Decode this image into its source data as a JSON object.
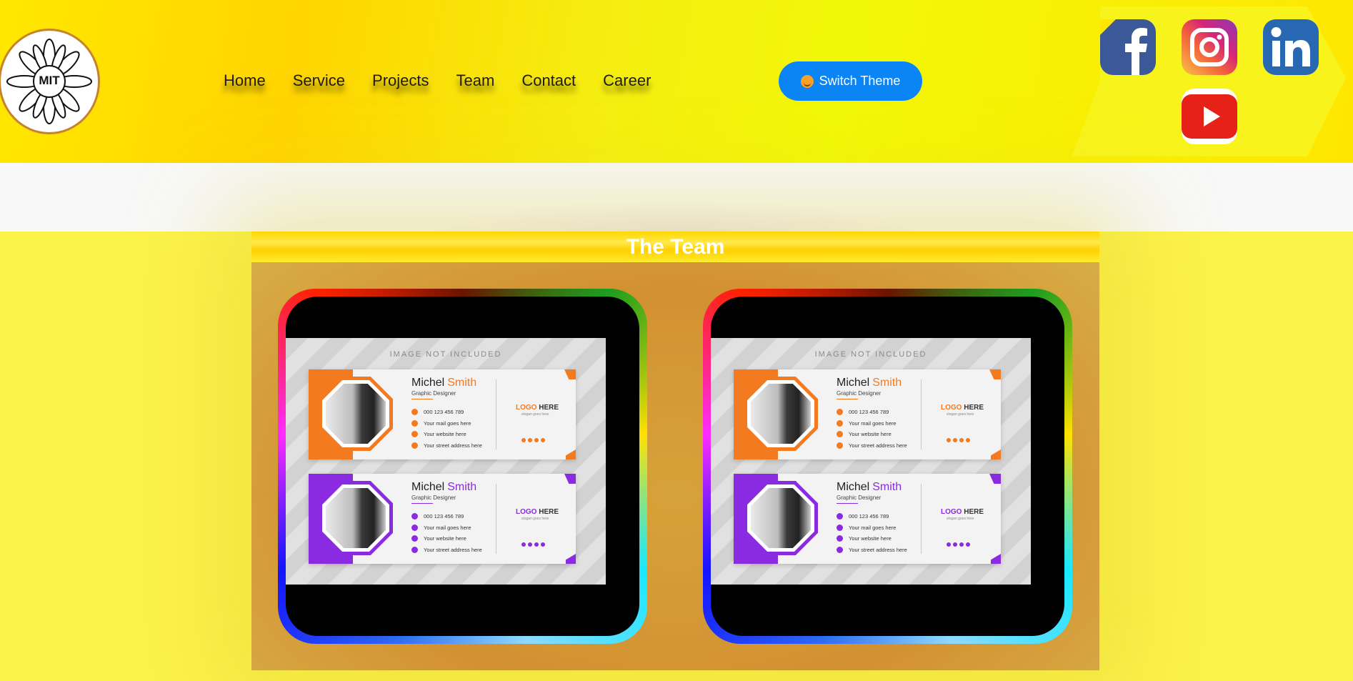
{
  "brand": {
    "logo_text": "MIT"
  },
  "nav": {
    "items": [
      {
        "label": "Home"
      },
      {
        "label": "Service"
      },
      {
        "label": "Projects"
      },
      {
        "label": "Team"
      },
      {
        "label": "Contact"
      },
      {
        "label": "Career"
      }
    ]
  },
  "theme_button": {
    "label": "Switch Theme",
    "icon": "smiley-emoji-icon"
  },
  "social": [
    {
      "name": "facebook-icon",
      "color": "#3b5998"
    },
    {
      "name": "instagram-icon",
      "color": "#d6247b"
    },
    {
      "name": "linkedin-icon",
      "color": "#2867b2"
    },
    {
      "name": "youtube-icon",
      "color": "#e62117"
    }
  ],
  "team": {
    "title": "The Team",
    "cards": [
      {
        "image_caption": "IMAGE NOT INCLUDED",
        "signatures": [
          {
            "first": "Michel",
            "last": "Smith",
            "role": "Graphic Designer",
            "phone": "000 123 456 789",
            "mail": "Your mail goes here",
            "website": "Your website here",
            "address": "Your street address here",
            "logo_bold": "LOGO",
            "logo_rest": "HERE",
            "slogan": "slogan goes here",
            "accent": "#f47a20"
          },
          {
            "first": "Michel",
            "last": "Smith",
            "role": "Graphic Designer",
            "phone": "000 123 456 789",
            "mail": "Your mail goes here",
            "website": "Your website here",
            "address": "Your street address here",
            "logo_bold": "LOGO",
            "logo_rest": "HERE",
            "slogan": "slogan goes here",
            "accent": "#8a2be2"
          }
        ]
      },
      {
        "image_caption": "IMAGE NOT INCLUDED",
        "signatures": [
          {
            "first": "Michel",
            "last": "Smith",
            "role": "Graphic Designer",
            "phone": "000 123 456 789",
            "mail": "Your mail goes here",
            "website": "Your website here",
            "address": "Your street address here",
            "logo_bold": "LOGO",
            "logo_rest": "HERE",
            "slogan": "slogan goes here",
            "accent": "#f47a20"
          },
          {
            "first": "Michel",
            "last": "Smith",
            "role": "Graphic Designer",
            "phone": "000 123 456 789",
            "mail": "Your mail goes here",
            "website": "Your website here",
            "address": "Your street address here",
            "logo_bold": "LOGO",
            "logo_rest": "HERE",
            "slogan": "slogan goes here",
            "accent": "#8a2be2"
          }
        ]
      }
    ]
  }
}
